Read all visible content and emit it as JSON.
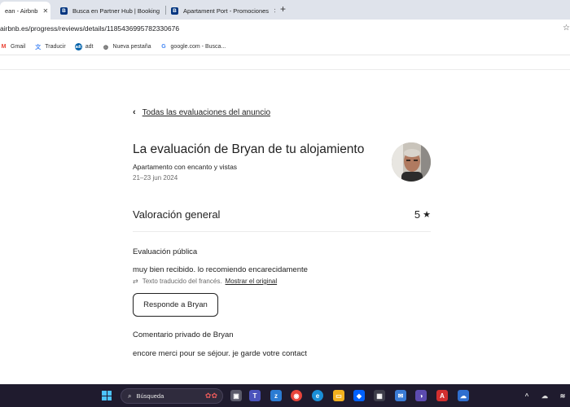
{
  "browser": {
    "tabs": [
      {
        "title": "ean - Airbnb",
        "active": true
      },
      {
        "title": "Busca en Partner Hub | Booking",
        "active": false
      },
      {
        "title": "Apartament Port - Promociones",
        "active": false
      }
    ],
    "new_tab_icon": "+",
    "url": "airbnb.es/progress/reviews/details/1185436995782330676",
    "bookmarks": [
      {
        "label": "Gmail",
        "icon": "gmail-icon",
        "color": "#ea4335"
      },
      {
        "label": "Traducir",
        "icon": "translate-icon",
        "color": "#4285f4"
      },
      {
        "label": "adt",
        "icon": "adt-icon",
        "color": "#0061aa"
      },
      {
        "label": "Nueva pestaña",
        "icon": "globe-icon",
        "color": "#555555"
      },
      {
        "label": "google.com - Busca...",
        "icon": "google-icon",
        "color": "#4285f4"
      }
    ]
  },
  "page": {
    "back_link": "Todas las evaluaciones del anuncio",
    "title": "La evaluación de Bryan de tu alojamiento",
    "listing_name": "Apartamento con encanto y vistas",
    "dates": "21–23 jun 2024",
    "overall_label": "Valoración general",
    "overall_score": "5",
    "public_review_heading": "Evaluación pública",
    "public_review_text": "muy bien recibido. lo recomiendo encarecidamente",
    "translated_note": "Texto traducido del francés.",
    "show_original_link": "Mostrar el original",
    "reply_button": "Responde a Bryan",
    "private_comment_heading": "Comentario privado de Bryan",
    "private_comment_text": "encore merci pour se séjour. je garde votre contact"
  },
  "taskbar": {
    "search_placeholder": "Búsqueda"
  },
  "colors": {
    "accent_text": "#222222",
    "muted_text": "#6a6a6a",
    "taskbar_bg": "#1f1b2e",
    "booking_blue": "#003580"
  }
}
